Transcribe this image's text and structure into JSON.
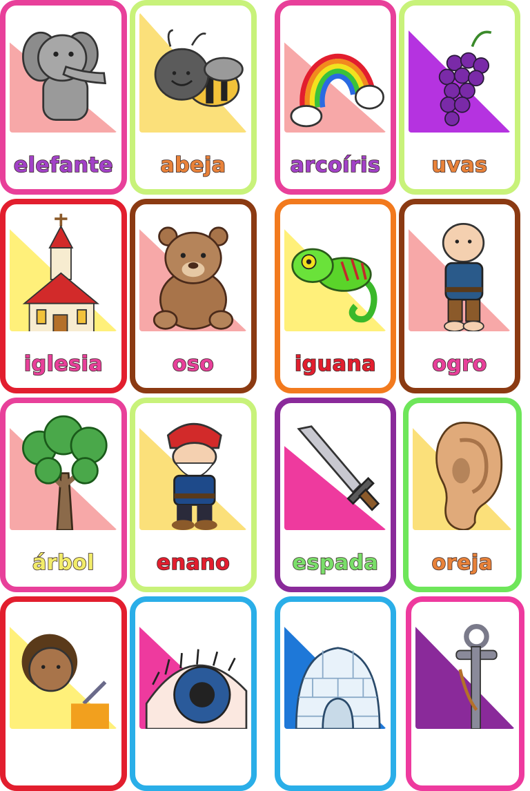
{
  "cards": [
    {
      "word": "elefante",
      "border": "#e8409a",
      "bg": "#f7a8a8",
      "text": "#a242c8",
      "icon": "elephant-icon"
    },
    {
      "word": "abeja",
      "border": "#c8f27a",
      "bg": "#fbe07a",
      "text": "#e8823a",
      "icon": "bee-icon"
    },
    {
      "word": "arcoíris",
      "border": "#e8409a",
      "bg": "#f7a8a8",
      "text": "#a242c8",
      "icon": "rainbow-icon"
    },
    {
      "word": "uvas",
      "border": "#c8f27a",
      "bg": "#b533e0",
      "text": "#e8823a",
      "icon": "grapes-icon"
    },
    {
      "word": "iglesia",
      "border": "#e21e2e",
      "bg": "#fff07a",
      "text": "#e8409a",
      "icon": "church-icon"
    },
    {
      "word": "oso",
      "border": "#8b3a12",
      "bg": "#f7a8a8",
      "text": "#e8409a",
      "icon": "bear-icon"
    },
    {
      "word": "iguana",
      "border": "#f27a1e",
      "bg": "#fff07a",
      "text": "#e21e2e",
      "icon": "iguana-icon"
    },
    {
      "word": "ogro",
      "border": "#8b3a12",
      "bg": "#f7a8a8",
      "text": "#e8409a",
      "icon": "ogre-icon"
    },
    {
      "word": "árbol",
      "border": "#e8409a",
      "bg": "#f7a8a8",
      "text": "#f2ec6a",
      "icon": "tree-icon"
    },
    {
      "word": "enano",
      "border": "#c8f27a",
      "bg": "#fbe07a",
      "text": "#e21e2e",
      "icon": "dwarf-icon"
    },
    {
      "word": "espada",
      "border": "#8a2a9a",
      "bg": "#ee3a9e",
      "text": "#7adf6a",
      "icon": "sword-icon"
    },
    {
      "word": "oreja",
      "border": "#6ee65a",
      "bg": "#fbe07a",
      "text": "#e8823a",
      "icon": "ear-icon"
    },
    {
      "word": "",
      "border": "#e21e2e",
      "bg": "#fff07a",
      "text": "#e21e2e",
      "icon": "nurse-icon"
    },
    {
      "word": "",
      "border": "#2aaee8",
      "bg": "#ee3a9e",
      "text": "#2aaee8",
      "icon": "eye-icon"
    },
    {
      "word": "",
      "border": "#2aaee8",
      "bg": "#1e78d8",
      "text": "#2aaee8",
      "icon": "igloo-icon"
    },
    {
      "word": "",
      "border": "#ee3a9e",
      "bg": "#8a2a9a",
      "text": "#ee3a9e",
      "icon": "anchor-icon"
    }
  ]
}
